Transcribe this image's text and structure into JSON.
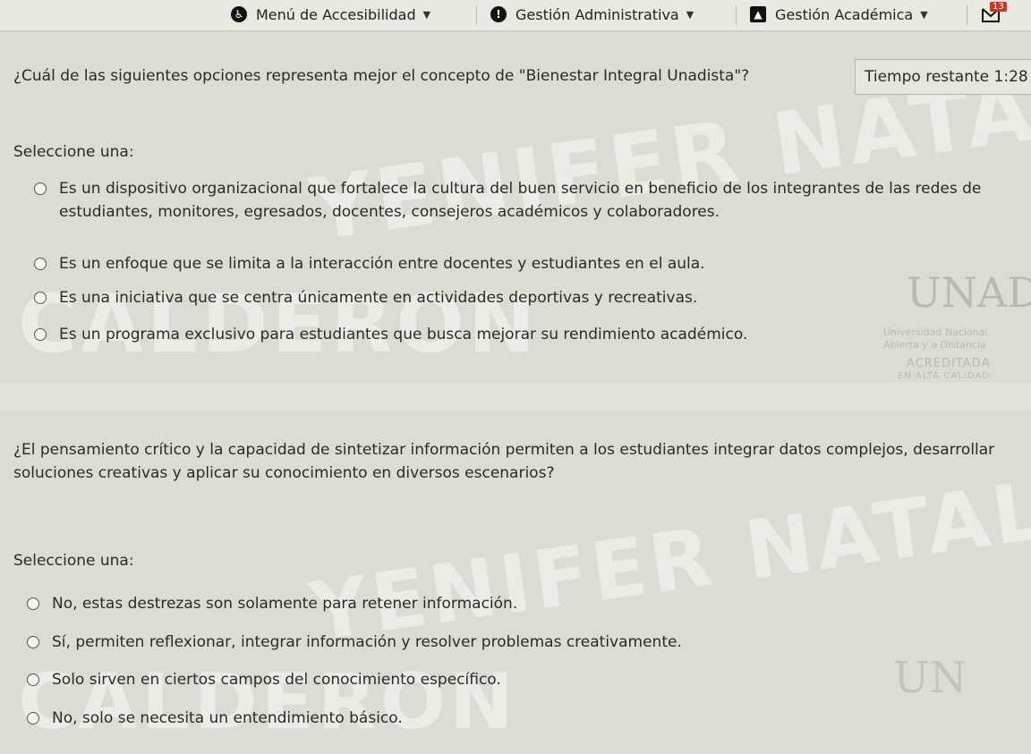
{
  "nav": {
    "accessibility_label": "Menú de Accesibilidad",
    "admin_label": "Gestión Administrativa",
    "academic_label": "Gestión Académica",
    "notifications_count": "13"
  },
  "q1": {
    "text": "¿Cuál de las siguientes opciones representa mejor el concepto de \"Bienestar Integral Unadista\"?",
    "prompt": "Seleccione una:",
    "options": [
      "Es un dispositivo organizacional que fortalece la cultura del buen servicio en beneficio de los integrantes de las redes de estudiantes, monitores, egresados, docentes, consejeros académicos y colaboradores.",
      "Es un enfoque que se limita a la interacción entre docentes y estudiantes en el aula.",
      "Es una iniciativa que se centra únicamente en actividades deportivas y recreativas.",
      "Es un programa exclusivo para estudiantes que busca mejorar su rendimiento académico."
    ]
  },
  "timer": {
    "label": "Tiempo restante",
    "value": "1:28"
  },
  "q2": {
    "text": "¿El pensamiento crítico y la capacidad de sintetizar información permiten a los estudiantes integrar datos complejos, desarrollar soluciones creativas y aplicar su conocimiento en diversos escenarios?",
    "prompt": "Seleccione una:",
    "options": [
      "No, estas destrezas son solamente para retener información.",
      "Sí, permiten reflexionar, integrar información y resolver problemas creativamente.",
      "Solo sirven en ciertos campos del conocimiento específico.",
      "No, solo se necesita un entendimiento básico."
    ]
  },
  "watermark": {
    "name_line1": "YENIFER NATALIA BARRERA",
    "name_line2": "CALDERON"
  },
  "logo": {
    "mark": "UNAD",
    "line1": "Universidad Nacional",
    "line2": "Abierta y a Distancia",
    "accreditation": "ACREDITADA",
    "accreditation_sub": "EN ALTA CALIDAD"
  },
  "colors": {
    "background": "#dcdcd2",
    "topbar": "#e9e9e2",
    "notification_badge": "#c0392b"
  },
  "icons": {
    "accessibility": "accessibility-icon",
    "admin": "alert-icon",
    "academic": "graduation-cap-icon",
    "notifications": "inbox-icon"
  }
}
